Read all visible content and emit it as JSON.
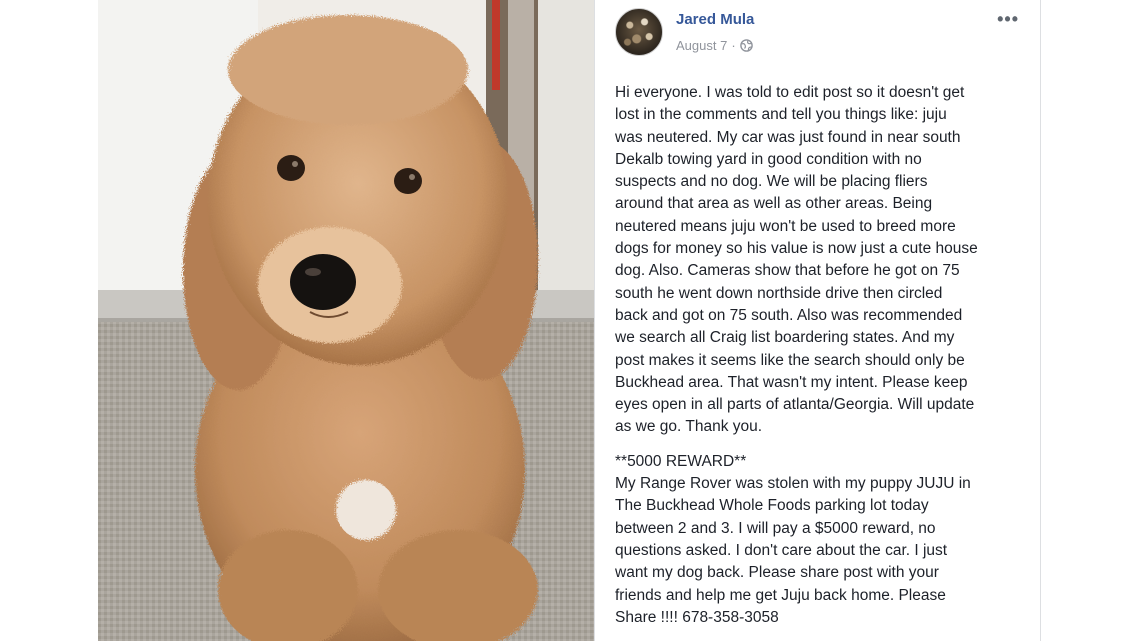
{
  "post": {
    "author": "Jared Mula",
    "date": "August 7",
    "separator": "·",
    "privacy_icon": "globe-icon",
    "more_icon": "more-options-icon",
    "more_label": "•••",
    "paragraph_1": "Hi everyone. I was told to edit post so it doesn't get\nlost in the comments and tell you things like: juju\nwas neutered. My car was just found in near south\nDekalb towing yard in good condition with no\nsuspects and no dog. We will be placing fliers\naround that area as well as other areas. Being\nneutered means juju won't be used to breed more\ndogs for money so his value is now just a cute house\ndog. Also. Cameras show that before he got on 75\nsouth he went down northside drive then circled\nback and got on 75 south. Also was recommended\nwe search all Craig list boardering states. And my\npost makes it seems like the search should only be\nBuckhead area. That wasn't my intent. Please keep\neyes open in all parts of atlanta/Georgia. Will update\nas we go. Thank you.",
    "reward_heading": "**5000 REWARD**",
    "paragraph_2": "My Range Rover was stolen with my puppy JUJU in\nThe Buckhead Whole Foods parking lot today\nbetween 2 and 3. I will pay a $5000 reward, no\nquestions asked. I don't care about the car. I just\nwant my dog back. Please share post with your\nfriends and help me get Juju back home. Please\nShare !!!! 678-358-3058"
  },
  "colors": {
    "author_link": "#365899",
    "meta_text": "#90949c",
    "body_text": "#1d2129"
  }
}
